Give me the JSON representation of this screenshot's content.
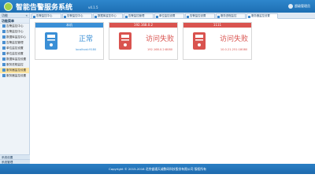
{
  "header": {
    "title": "智能告警服务系统",
    "version": "v4.1.5",
    "user": "超级管理员"
  },
  "sidebar": {
    "head": "功能",
    "section": "功能菜单",
    "items": [
      {
        "label": "告警监控中心"
      },
      {
        "label": "告警监控中心"
      },
      {
        "label": "数据库监控中心"
      },
      {
        "label": "告警监控管理"
      },
      {
        "label": "单位监控设置"
      },
      {
        "label": "单位监控设置"
      },
      {
        "label": "数据库监控设置"
      },
      {
        "label": "服务进程监控"
      },
      {
        "label": "服务器监控设置"
      },
      {
        "label": "服务器监控设置"
      }
    ],
    "footer": [
      "系统设置",
      "系统管理"
    ]
  },
  "tabs": [
    {
      "label": "告警监控中心"
    },
    {
      "label": "告警监控中心"
    },
    {
      "label": "数据库监控中心"
    },
    {
      "label": "告警监控管理"
    },
    {
      "label": "单位监控设置"
    },
    {
      "label": "告警监控设置"
    },
    {
      "label": "服务进程监控"
    },
    {
      "label": "服务器监控设置"
    }
  ],
  "cards": [
    {
      "title": "本机",
      "status": "正常",
      "address": "localhost:9180",
      "state": "ok"
    },
    {
      "title": "192.168.0.2",
      "status": "访问失败",
      "address": "192.168.0.2:8080",
      "state": "error"
    },
    {
      "title": "1111",
      "status": "访问失败",
      "address": "10.0.21.251:18080",
      "state": "error"
    }
  ],
  "footer": {
    "copyright": "Copyright © 2015-2018 北京盛通天诚数码科技股份有限公司 版权所有"
  },
  "colors": {
    "primary": "#2a7fc6",
    "ok": "#3a8fd6",
    "error": "#d9534f"
  }
}
